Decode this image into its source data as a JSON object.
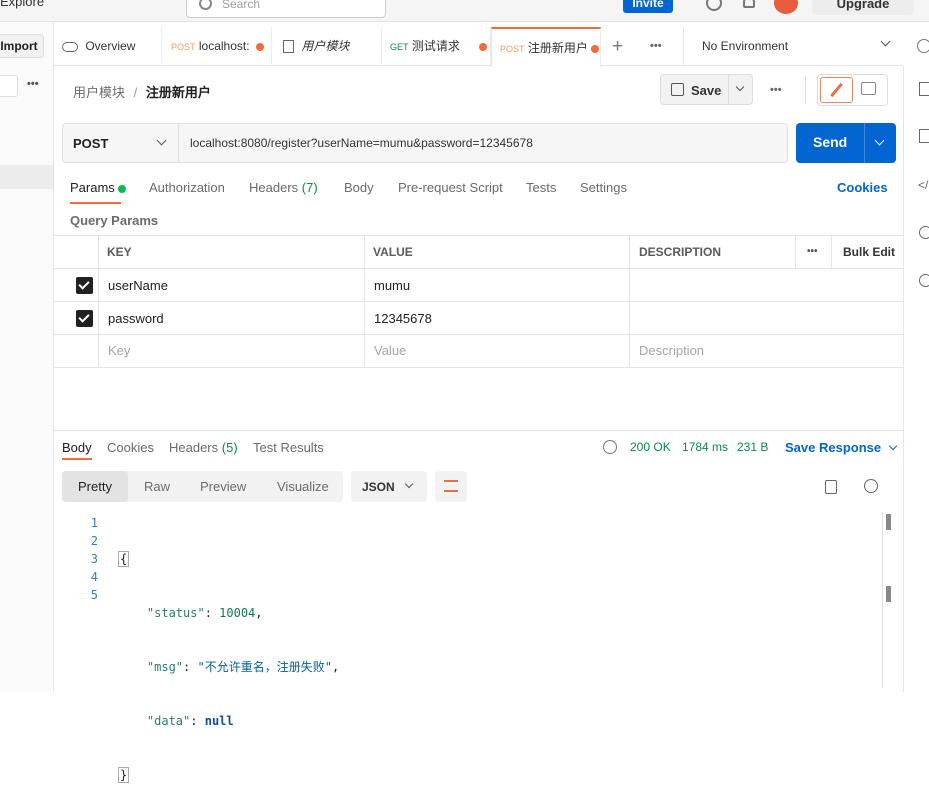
{
  "app": {
    "explore_label": "Explore",
    "search_placeholder": "Search",
    "invite_label": "Invite",
    "upgrade_label": "Upgrade",
    "import_label": "Import"
  },
  "tabs": [
    {
      "label": "Overview"
    },
    {
      "method": "POST",
      "label": "localhost:"
    },
    {
      "label": "用户模块"
    },
    {
      "method": "GET",
      "label": "测试请求"
    },
    {
      "method": "POST",
      "label": "注册新用户"
    }
  ],
  "environment": "No Environment",
  "breadcrumb": {
    "parent": "用户模块",
    "sep": "/",
    "current": "注册新用户"
  },
  "toolbar": {
    "save_label": "Save"
  },
  "request": {
    "method": "POST",
    "url": "localhost:8080/register?userName=mumu&password=12345678",
    "send_label": "Send"
  },
  "request_tabs": {
    "params": "Params",
    "authorization": "Authorization",
    "headers": "Headers",
    "headers_count": "(7)",
    "body": "Body",
    "prerequest": "Pre-request Script",
    "tests": "Tests",
    "settings": "Settings",
    "cookies": "Cookies"
  },
  "query_params": {
    "title": "Query Params",
    "columns": {
      "key": "KEY",
      "value": "VALUE",
      "description": "DESCRIPTION",
      "bulk_edit": "Bulk Edit"
    },
    "rows": [
      {
        "key": "userName",
        "value": "mumu",
        "description": ""
      },
      {
        "key": "password",
        "value": "12345678",
        "description": ""
      }
    ],
    "placeholder": {
      "key": "Key",
      "value": "Value",
      "description": "Description"
    }
  },
  "response_tabs": {
    "body": "Body",
    "cookies": "Cookies",
    "headers": "Headers",
    "headers_count": "(5)",
    "test_results": "Test Results"
  },
  "response_status": {
    "status": "200 OK",
    "time": "1784 ms",
    "size": "231 B",
    "save_label": "Save Response"
  },
  "view_modes": {
    "pretty": "Pretty",
    "raw": "Raw",
    "preview": "Preview",
    "visualize": "Visualize",
    "format": "JSON"
  },
  "response_body": {
    "lines": [
      "1",
      "2",
      "3",
      "4",
      "5"
    ],
    "open": "{",
    "close": "}",
    "status_key": "\"status\"",
    "status_val": "10004",
    "msg_key": "\"msg\"",
    "msg_val": "\"不允许重名，注册失败\"",
    "data_key": "\"data\"",
    "data_val": "null"
  },
  "colors": {
    "accent": "#0265d2",
    "post": "#f29e64",
    "ok": "#0b8a48",
    "tab_dot": "#f26b3a"
  }
}
